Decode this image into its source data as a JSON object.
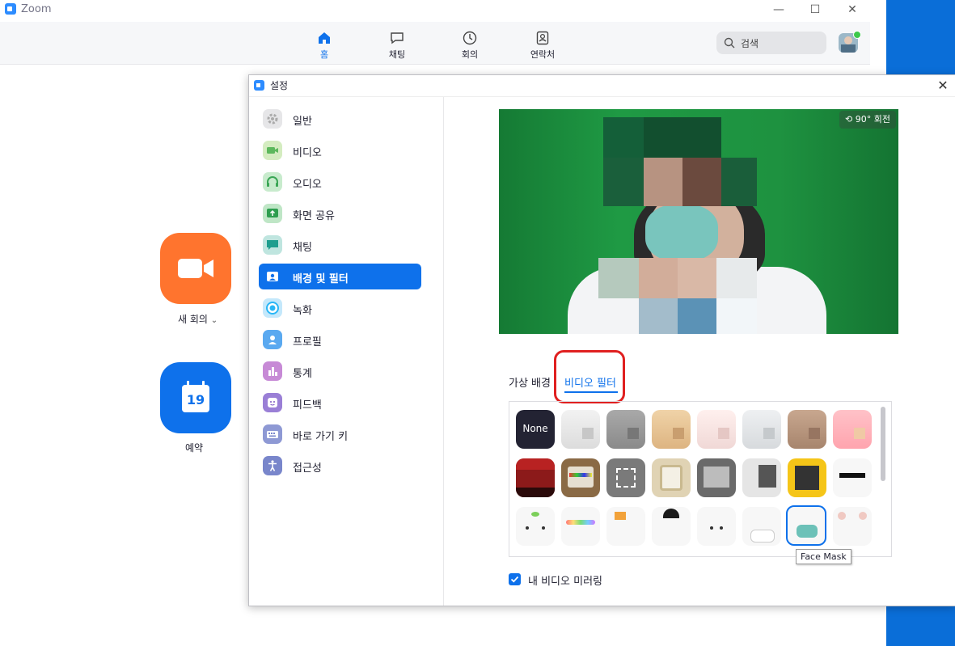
{
  "window": {
    "title": "Zoom",
    "minimize": "—",
    "maximize": "☐",
    "close": "✕"
  },
  "nav": {
    "items": [
      {
        "label": "홈",
        "icon": "home-icon"
      },
      {
        "label": "채팅",
        "icon": "chat-icon"
      },
      {
        "label": "회의",
        "icon": "clock-icon"
      },
      {
        "label": "연락처",
        "icon": "contacts-icon"
      }
    ],
    "search_placeholder": "검색"
  },
  "home": {
    "new_meeting_label": "새 회의",
    "schedule_label": "예약",
    "calendar_day": "19"
  },
  "settings": {
    "title": "설정",
    "sidebar": [
      {
        "label": "일반",
        "color": "#c7c7cc"
      },
      {
        "label": "비디오",
        "color": "#8bc34a"
      },
      {
        "label": "오디오",
        "color": "#66bb6a"
      },
      {
        "label": "화면 공유",
        "color": "#4caf50"
      },
      {
        "label": "채팅",
        "color": "#26a69a"
      },
      {
        "label": "배경 및 필터",
        "color": "#0e71eb"
      },
      {
        "label": "녹화",
        "color": "#29b6f6"
      },
      {
        "label": "프로필",
        "color": "#42a5f5"
      },
      {
        "label": "통계",
        "color": "#ab47bc"
      },
      {
        "label": "피드백",
        "color": "#7e57c2"
      },
      {
        "label": "바로 가기 키",
        "color": "#7986cb"
      },
      {
        "label": "접근성",
        "color": "#5c6bc0"
      }
    ],
    "rotate_label": "90° 회전",
    "tabs": {
      "virtual_bg": "가상 배경",
      "video_filter": "비디오 필터"
    },
    "none_label": "None",
    "tooltip": "Face Mask",
    "mirror_label": "내 비디오 미러링"
  },
  "colors": {
    "accent": "#0e71eb",
    "highlight": "#e02020",
    "green_screen": "#1e9240"
  }
}
